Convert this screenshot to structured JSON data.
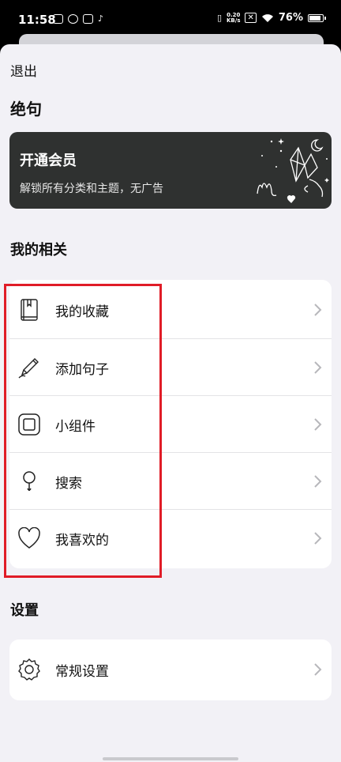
{
  "status_bar": {
    "time": "11:58",
    "net_speed_top": "0.20",
    "net_speed_bottom": "KB/s",
    "battery": "76%"
  },
  "header": {
    "exit_label": "退出",
    "app_title": "绝句"
  },
  "vip": {
    "title": "开通会员",
    "subtitle": "解锁所有分类和主题，无广告"
  },
  "my_section": {
    "title": "我的相关",
    "items": [
      {
        "label": "我的收藏",
        "icon": "book-icon"
      },
      {
        "label": "添加句子",
        "icon": "pencil-icon"
      },
      {
        "label": "小组件",
        "icon": "widget-icon"
      },
      {
        "label": "搜索",
        "icon": "magnifier-icon"
      },
      {
        "label": "我喜欢的",
        "icon": "heart-icon"
      }
    ]
  },
  "settings_section": {
    "title": "设置",
    "items": [
      {
        "label": "常规设置",
        "icon": "gear-icon"
      }
    ]
  },
  "colors": {
    "background": "#f2f1f6",
    "card": "#ffffff",
    "vip_card": "#2f3130",
    "highlight": "#e01c27"
  }
}
